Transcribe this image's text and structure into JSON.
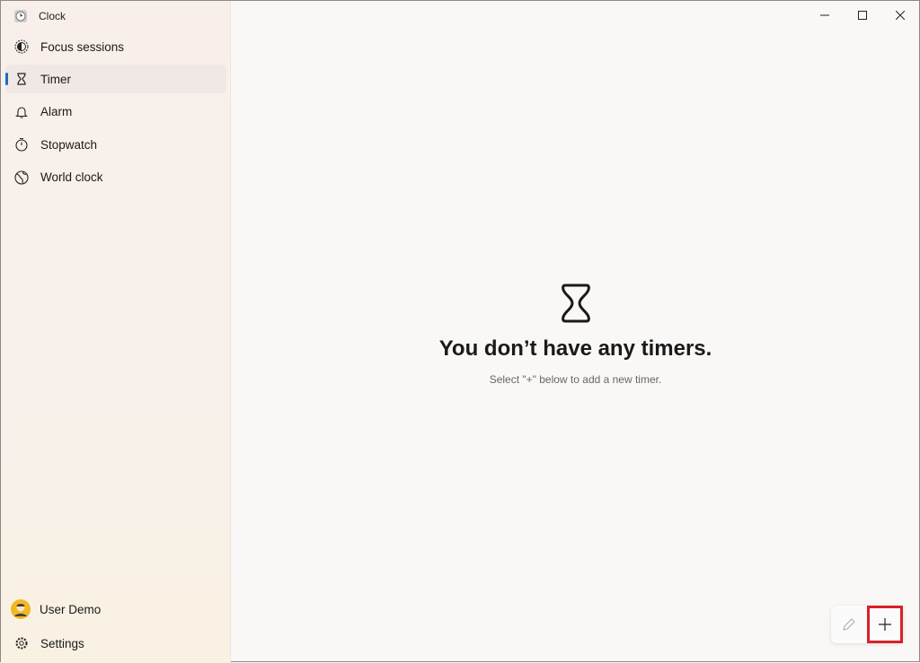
{
  "app": {
    "title": "Clock"
  },
  "sidebar": {
    "items": [
      {
        "label": "Focus sessions",
        "icon": "focus-icon"
      },
      {
        "label": "Timer",
        "icon": "hourglass-icon",
        "active": true
      },
      {
        "label": "Alarm",
        "icon": "bell-icon"
      },
      {
        "label": "Stopwatch",
        "icon": "stopwatch-icon"
      },
      {
        "label": "World clock",
        "icon": "globe-icon"
      }
    ],
    "user": "User Demo",
    "settings": "Settings"
  },
  "main": {
    "empty_title": "You don’t have any timers.",
    "empty_hint": "Select \"+\" below to add a new timer."
  },
  "colors": {
    "accent": "#1a6bbd",
    "highlight": "#d9202b"
  }
}
